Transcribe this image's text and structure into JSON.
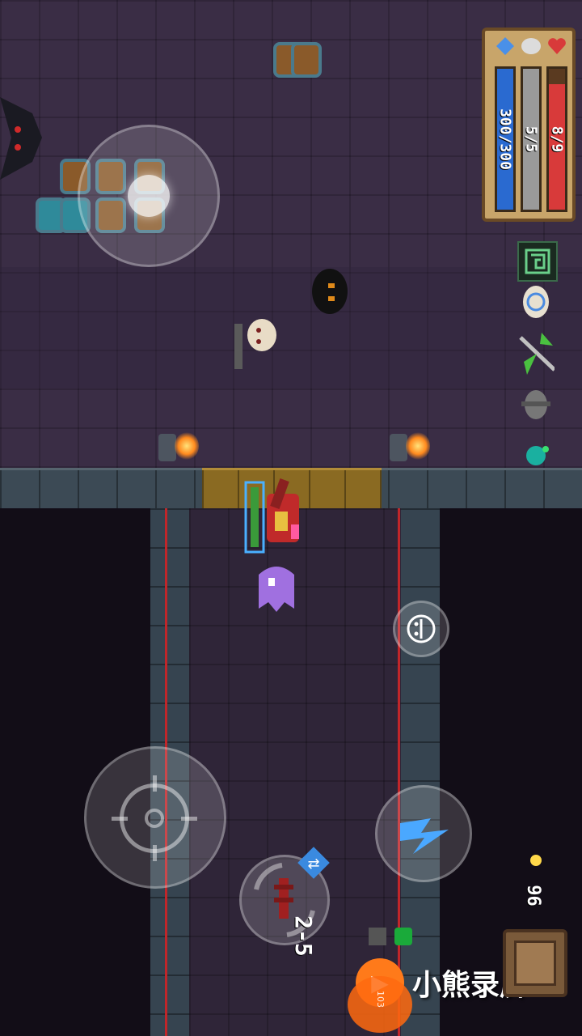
{
  "hud": {
    "hp": {
      "text": "8/9",
      "value": 8,
      "max": 9,
      "color": "#d83a3a"
    },
    "armor": {
      "text": "5/5",
      "value": 5,
      "max": 5,
      "color": "#9a9a9a"
    },
    "energy": {
      "text": "300/300",
      "value": 300,
      "max": 300,
      "color": "#2a6ad0"
    },
    "icons": {
      "energy": "diamond-icon",
      "armor": "shield-icon",
      "hp": "heart-icon"
    }
  },
  "buffs": [
    "maze-buff-icon",
    "shell-buff-icon",
    "blade-buff-icon",
    "skull-buff-icon",
    "potion-buff-icon"
  ],
  "gold": {
    "value": "96",
    "icon": "coin-icon"
  },
  "weapon": {
    "cost": "2-5",
    "icon": "weapon-icon",
    "swap_icon": "swap-icon"
  },
  "skill_button": {
    "icon": "lightning-icon",
    "color": "#4aa8ff"
  },
  "emote_button": {
    "icon": "emote-icon"
  },
  "watermark": {
    "text": "小熊录屏",
    "badge": "103"
  },
  "colors": {
    "floor": "#3a2d45",
    "wall": "#3c4a55",
    "gate": "#8a6a22",
    "laser": "#c0262a"
  }
}
